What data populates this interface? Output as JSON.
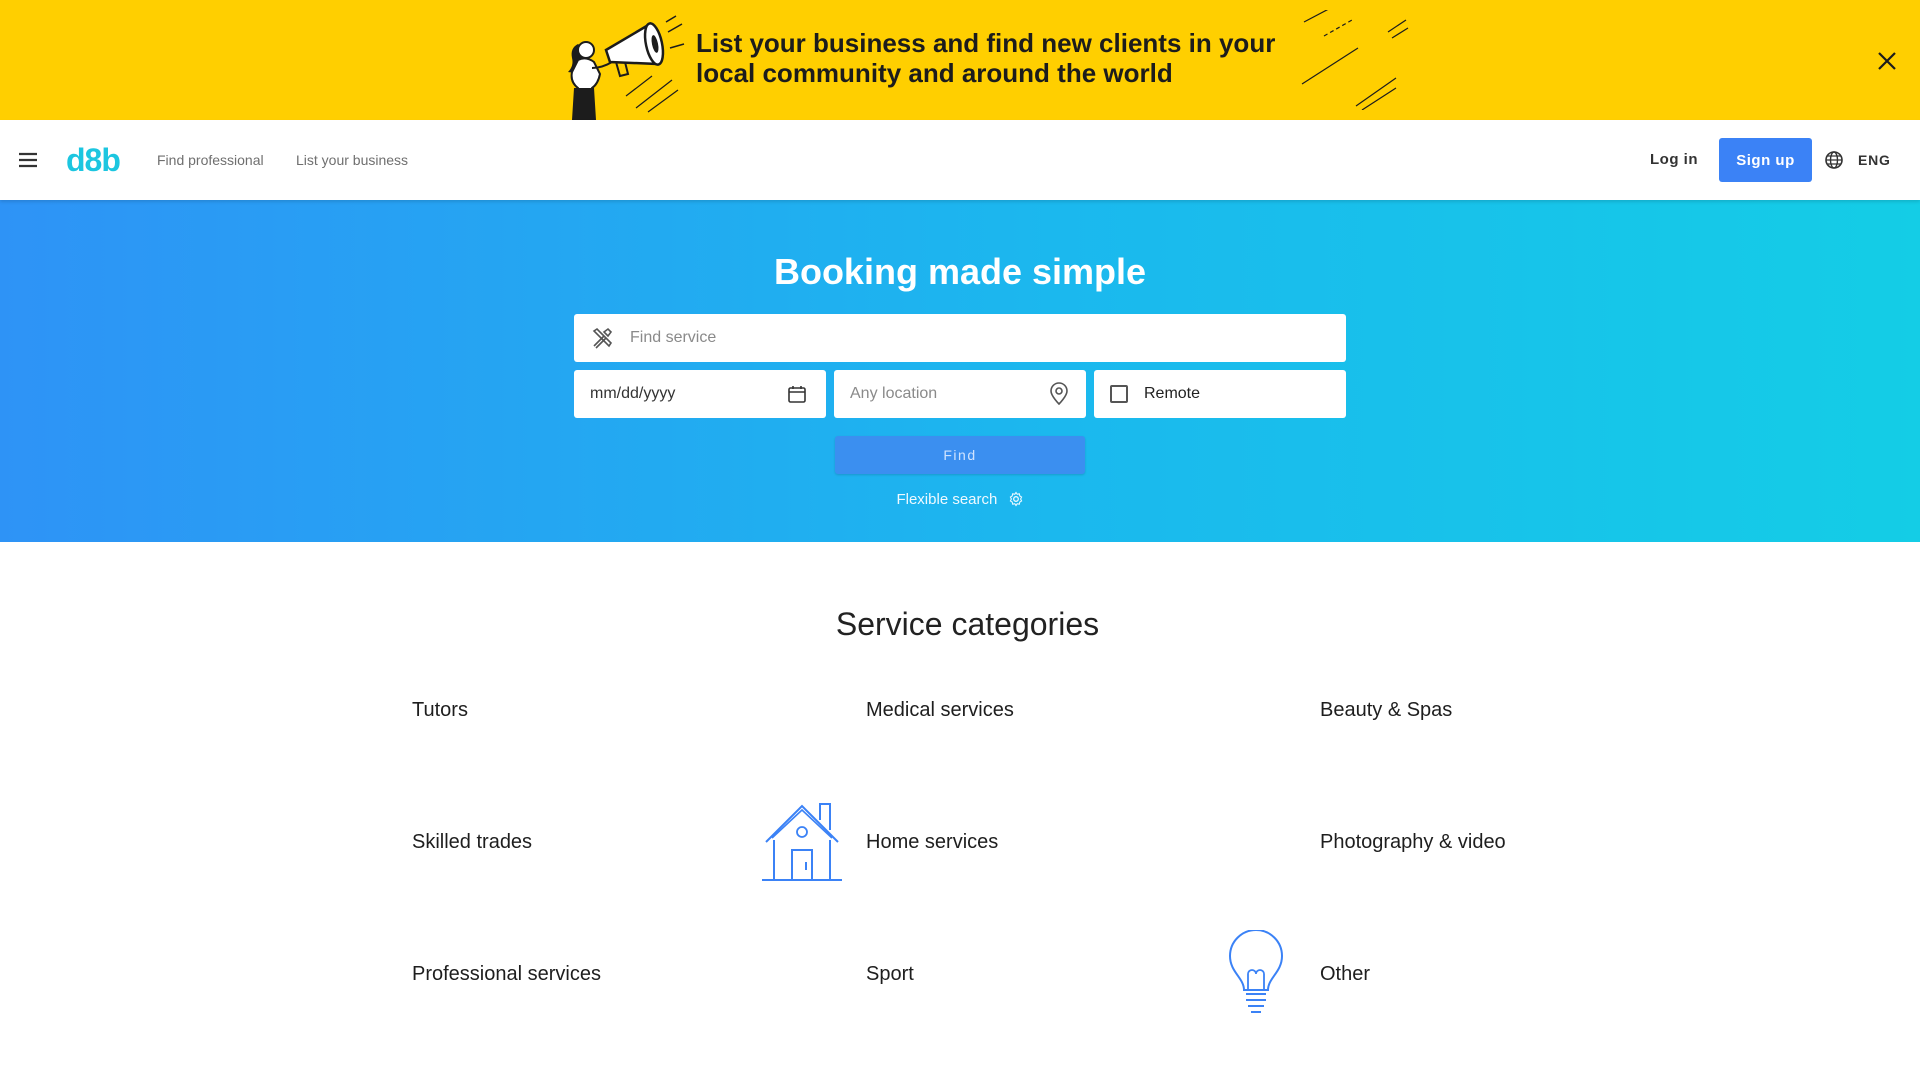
{
  "promo": {
    "text": "List your business and find new clients in your local community and around the world",
    "close_icon": "close-icon"
  },
  "header": {
    "logo": "d8b",
    "nav": [
      "Find professional",
      "List your business"
    ],
    "login": "Log in",
    "signup": "Sign up",
    "language": "ENG"
  },
  "hero": {
    "title": "Booking made simple",
    "service_placeholder": "Find service",
    "date_placeholder": "mm/dd/yyyy",
    "location_placeholder": "Any location",
    "remote_label": "Remote",
    "find_button": "Find",
    "flexible_search": "Flexible search"
  },
  "categories": {
    "title": "Service categories",
    "items": [
      "Tutors",
      "Medical services",
      "Beauty & Spas",
      "Skilled trades",
      "Home services",
      "Photography & video",
      "Professional services",
      "Sport",
      "Other"
    ]
  },
  "colors": {
    "banner": "#ffcf00",
    "accent": "#3b82f6",
    "logo": "#1cc6e0",
    "hero_start": "#2e93f6",
    "hero_end": "#14cde6"
  }
}
